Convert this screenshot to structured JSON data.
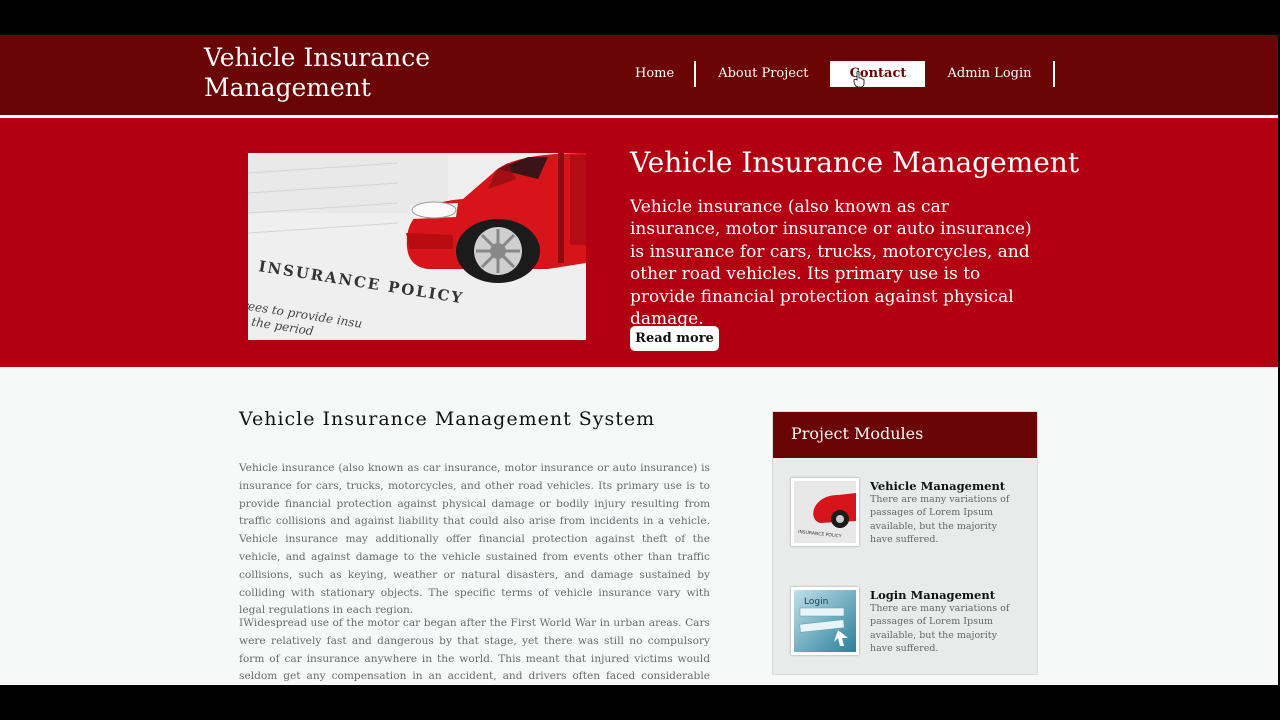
{
  "header": {
    "brand_line1": "Vehicle Insurance",
    "brand_line2": "Management",
    "nav": [
      {
        "label": "Home"
      },
      {
        "label": "About Project"
      },
      {
        "label": "Contact",
        "active": true
      },
      {
        "label": "Admin Login"
      }
    ]
  },
  "hero": {
    "title": "Vehicle Insurance Management",
    "text": "Vehicle insurance (also known as car insurance, motor insurance or auto insurance) is insurance for cars, trucks, motorcycles, and other road vehicles. Its primary use is to provide financial protection against physical damage.",
    "button": "Read more",
    "image_caption": "INSURANCE POLICY",
    "image_text": "rees to provide insu",
    "image_text2": "g the period"
  },
  "main": {
    "title": "Vehicle Insurance Management System",
    "paragraphs": [
      "Vehicle insurance (also known as car insurance, motor insurance or auto insurance) is insurance for cars, trucks, motorcycles, and other road vehicles. Its primary use is to provide financial protection against physical damage or bodily injury resulting from traffic collisions and against liability that could also arise from incidents in a vehicle. Vehicle insurance may additionally offer financial protection against theft of the vehicle, and against damage to the vehicle sustained from events other than traffic collisions, such as keying, weather or natural disasters, and damage sustained by colliding with stationary objects. The specific terms of vehicle insurance vary with legal regulations in each region.",
      "IWidespread use of the motor car began after the First World War in urban areas. Cars were relatively fast and dangerous by that stage, yet there was still no compulsory form of car insurance anywhere in the world. This meant that injured victims would seldom get any compensation in an accident, and drivers often faced considerable costs for damage to their car and property."
    ]
  },
  "sidebar": {
    "title": "Project Modules",
    "modules": [
      {
        "title": "Vehicle Management",
        "text": "There are many variations of passages of Lorem Ipsum available, but the majority have suffered.",
        "thumb_text": "INSURANCE POLICY"
      },
      {
        "title": "Login Management",
        "text": "There are many variations of passages of Lorem Ipsum available, but the majority have suffered.",
        "thumb_text": "Login"
      }
    ]
  },
  "colors": {
    "header_bg": "#6b0404",
    "hero_bg": "#b20012",
    "page_bg": "#f7f9f9"
  },
  "icons": [
    "cursor-pointer-icon"
  ]
}
